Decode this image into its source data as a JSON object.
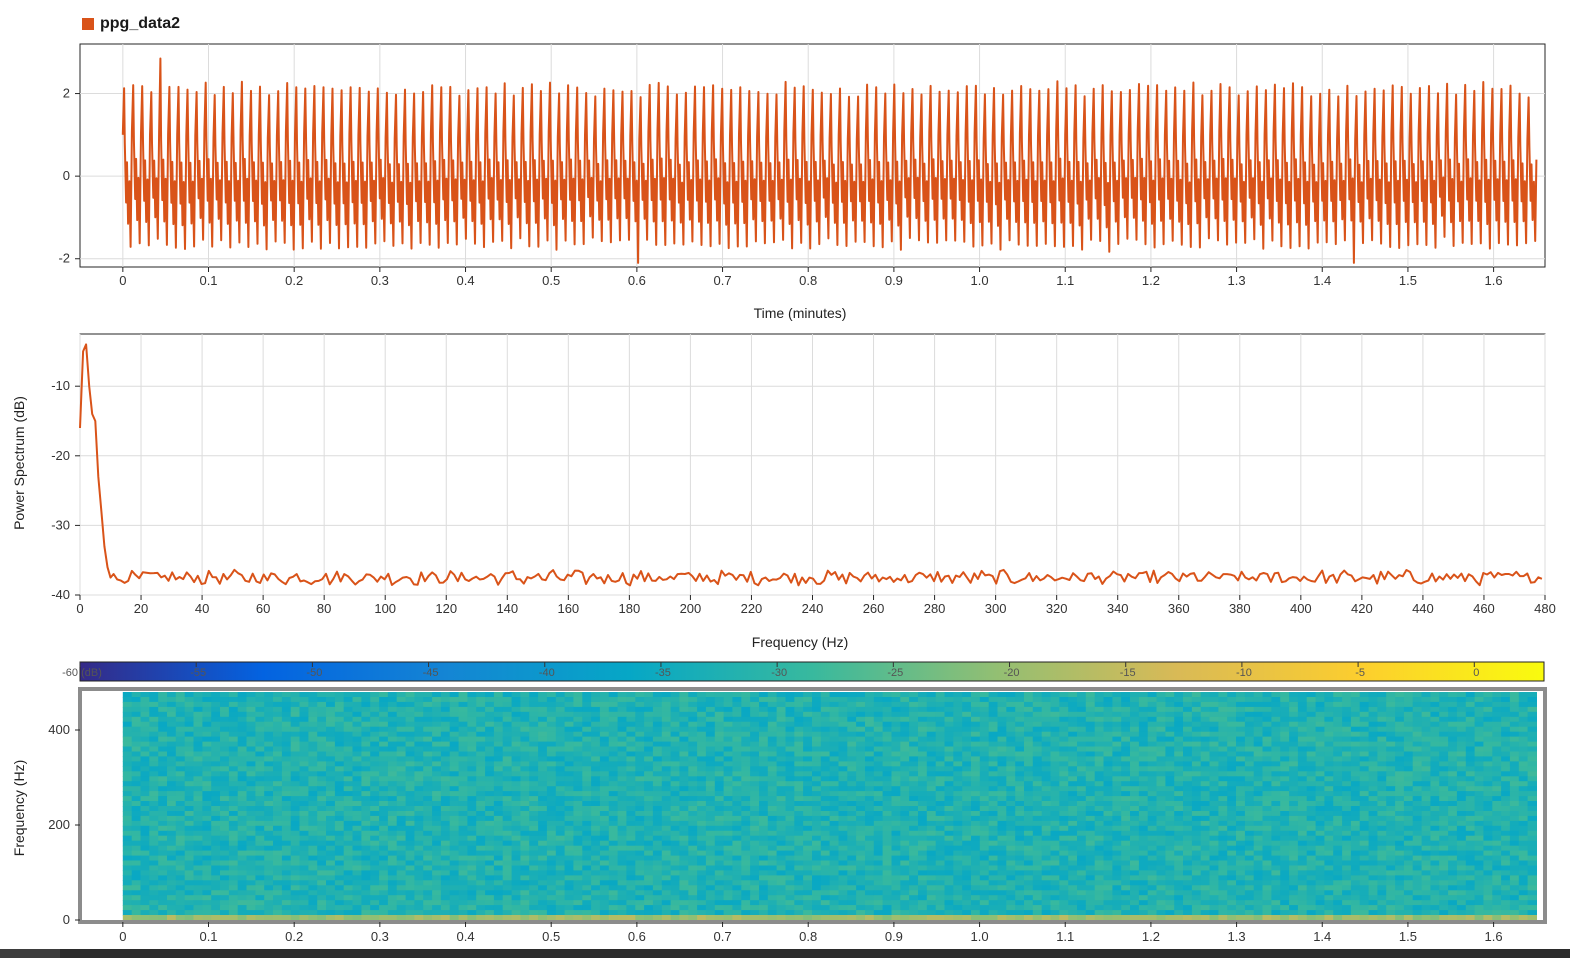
{
  "legend": {
    "label": "ppg_data2",
    "color": "#d95319"
  },
  "series_color": "#d95319",
  "chart_data": [
    {
      "type": "line",
      "name": "time-domain",
      "series": [
        {
          "name": "ppg_data2",
          "x_range": [
            0,
            1.65
          ],
          "y_range": [
            -2.1,
            2.85
          ],
          "approx_cycles": 156
        }
      ],
      "xlabel": "Time (minutes)",
      "ylabel": "",
      "xlim": [
        -0.05,
        1.66
      ],
      "ylim": [
        -2.2,
        3.2
      ],
      "xticks": [
        "0",
        "0.1",
        "0.2",
        "0.3",
        "0.4",
        "0.5",
        "0.6",
        "0.7",
        "0.8",
        "0.9",
        "1.0",
        "1.1",
        "1.2",
        "1.3",
        "1.4",
        "1.5",
        "1.6"
      ],
      "yticks": [
        "2",
        "0",
        "-2"
      ],
      "grid": true
    },
    {
      "type": "line",
      "name": "power-spectrum",
      "series": [
        {
          "name": "ppg_data2",
          "x": [
            0,
            1,
            2,
            3,
            4,
            5,
            6,
            7,
            8,
            9,
            10,
            480
          ],
          "y": [
            -16,
            -5,
            -4,
            -10,
            -14,
            -15,
            -23,
            -28,
            -33,
            -36,
            -37.5,
            -37.8
          ]
        }
      ],
      "noise_floor": -37.5,
      "xlabel": "Frequency (Hz)",
      "ylabel": "Power Spectrum (dB)",
      "xlim": [
        0,
        480
      ],
      "ylim": [
        -40,
        -2.5
      ],
      "xticks": [
        "0",
        "20",
        "40",
        "60",
        "80",
        "100",
        "120",
        "140",
        "160",
        "180",
        "200",
        "220",
        "240",
        "260",
        "280",
        "300",
        "320",
        "340",
        "360",
        "380",
        "400",
        "420",
        "440",
        "460",
        "480"
      ],
      "yticks": [
        "-10",
        "-20",
        "-30",
        "-40"
      ],
      "grid": true
    },
    {
      "type": "heatmap",
      "name": "spectrogram",
      "x_range": [
        0,
        1.65
      ],
      "y_range": [
        0,
        480
      ],
      "value_range_db": [
        -60,
        3
      ],
      "typical_db": [
        -36,
        -28
      ],
      "xlabel": "",
      "ylabel": "Frequency (Hz)",
      "xticks": [
        "0",
        "0.1",
        "0.2",
        "0.3",
        "0.4",
        "0.5",
        "0.6",
        "0.7",
        "0.8",
        "0.9",
        "1.0",
        "1.1",
        "1.2",
        "1.3",
        "1.4",
        "1.5",
        "1.6"
      ],
      "yticks": [
        "400",
        "200",
        "0"
      ],
      "colorbar": {
        "ticks": [
          "-60 (dB)",
          "-55",
          "-50",
          "-45",
          "-40",
          "-35",
          "-30",
          "-25",
          "-20",
          "-15",
          "-10",
          "-5",
          "0"
        ],
        "colormap": [
          "#352a87",
          "#0363e1",
          "#1485d4",
          "#06a7c6",
          "#38b99e",
          "#92bf73",
          "#d9ba56",
          "#fcce2e",
          "#f9fb0e"
        ]
      }
    }
  ]
}
